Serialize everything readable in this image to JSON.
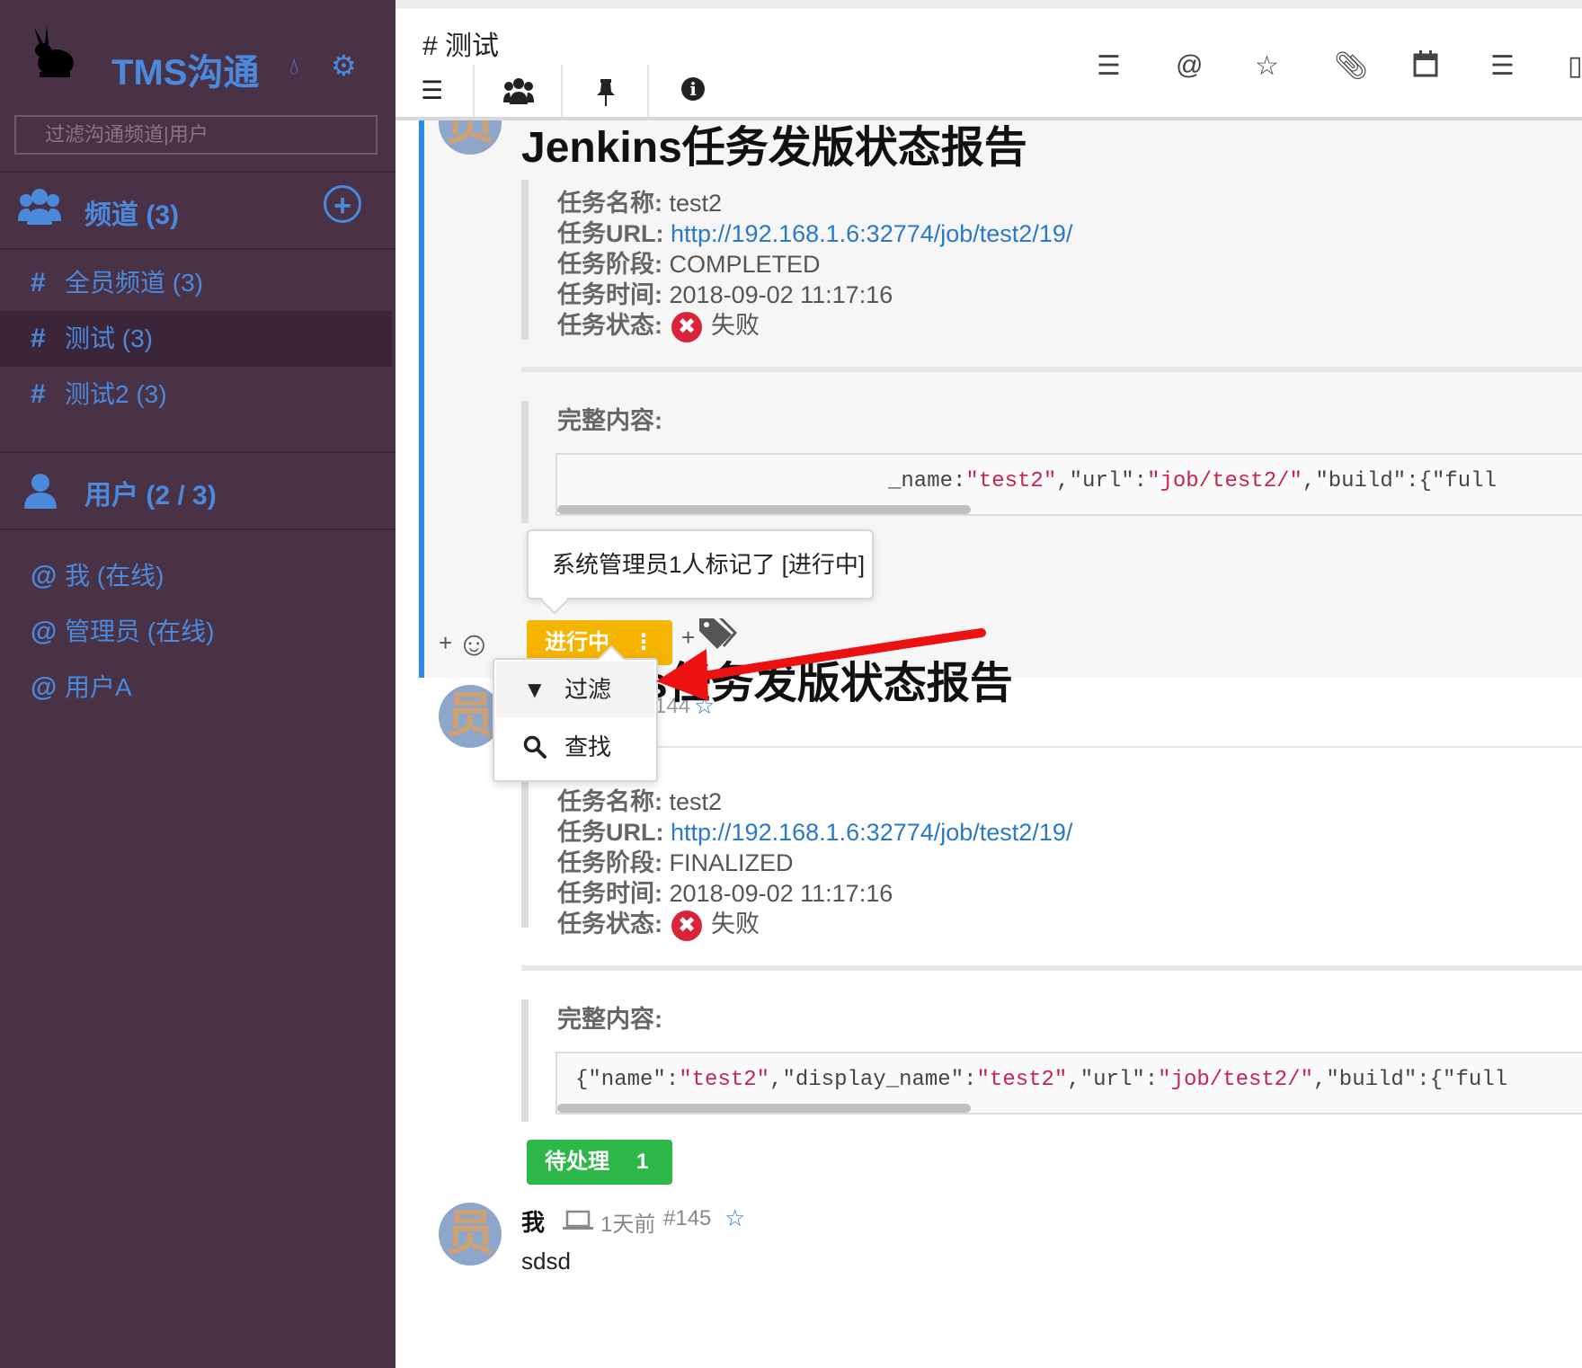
{
  "sidebar": {
    "app_title": "TMS沟通",
    "filter_placeholder": "过滤沟通频道|用户",
    "channels_header": "频道 (3)",
    "channels": [
      {
        "prefix": "#",
        "label": "全员频道 (3)"
      },
      {
        "prefix": "#",
        "label": "测试 (3)"
      },
      {
        "prefix": "#",
        "label": "测试2 (3)"
      }
    ],
    "users_header": "用户 (2 / 3)",
    "users": [
      {
        "prefix": "@",
        "label": "我 (在线)"
      },
      {
        "prefix": "@",
        "label": "管理员 (在线)"
      },
      {
        "prefix": "@",
        "label": "用户A"
      }
    ]
  },
  "header": {
    "channel_title": "# 测试"
  },
  "messages": [
    {
      "avatar_char": "员",
      "title": "Jenkins任务发版状态报告",
      "fields": {
        "name_label": "任务名称:",
        "name_value": "test2",
        "url_label": "任务URL:",
        "url_value": "http://192.168.1.6:32774/job/test2/19/",
        "phase_label": "任务阶段:",
        "phase_value": "COMPLETED",
        "time_label": "任务时间:",
        "time_value": "2018-09-02 11:17:16",
        "status_label": "任务状态:",
        "status_value": "失败"
      },
      "full_label": "完整内容:",
      "code_visible": [
        "_name",
        ":",
        "\"test2\"",
        ",",
        "\"url\"",
        ":",
        "\"job/test2/\"",
        ",",
        "\"build\"",
        ":{",
        "\"full"
      ],
      "tooltip": "系统管理员1人标记了 [进行中]",
      "tag_label": "进行中",
      "tag_menu": [
        "过滤",
        "查找"
      ]
    },
    {
      "avatar_char": "员",
      "meta_number": "144",
      "title": "s任务发版状态报告",
      "fields": {
        "name_label": "任务名称:",
        "name_value": "test2",
        "url_label": "任务URL:",
        "url_value": "http://192.168.1.6:32774/job/test2/19/",
        "phase_label": "任务阶段:",
        "phase_value": "FINALIZED",
        "time_label": "任务时间:",
        "time_value": "2018-09-02 11:17:16",
        "status_label": "任务状态:",
        "status_value": "失败"
      },
      "full_label": "完整内容:",
      "code_visible": [
        "{",
        "\"name\"",
        ":",
        "\"test2\"",
        ",",
        "\"display_name\"",
        ":",
        "\"test2\"",
        ",",
        "\"url\"",
        ":",
        "\"job/test2/\"",
        ",",
        "\"build\"",
        ":{",
        "\"full"
      ],
      "tag_label": "待处理",
      "tag_count": "1"
    },
    {
      "avatar_char": "员",
      "author": "我",
      "time": "1天前",
      "number": "#145",
      "body": "sdsd"
    }
  ],
  "colors": {
    "sidebar_bg": "#4a3246",
    "accent": "#4a89dc",
    "tag_in_progress": "#f4b400",
    "tag_pending": "#2eb84a",
    "fail": "#d9233a",
    "annotation_arrow": "#ee1111"
  },
  "icons": [
    "bunny-logo-icon",
    "drop-icon",
    "cogs-icon",
    "users-icon",
    "plus-circle-icon",
    "user-icon",
    "menu-icon",
    "people-icon",
    "pin-icon",
    "info-icon",
    "list-icon",
    "at-icon",
    "star-icon",
    "paperclip-icon",
    "calendar-icon",
    "list-alt-icon",
    "panel-icon",
    "smile-icon",
    "tags-icon",
    "filter-icon",
    "search-icon",
    "laptop-icon"
  ]
}
